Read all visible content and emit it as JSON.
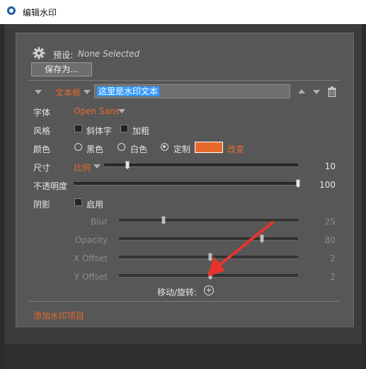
{
  "window": {
    "title": "编辑水印"
  },
  "preset": {
    "label": "预设:",
    "value": "None Selected",
    "save_as": "保存为..."
  },
  "item": {
    "type_label": "文本框",
    "text": "这里是水印文本"
  },
  "font": {
    "label": "字体",
    "value": "Open Sans"
  },
  "style": {
    "label": "风格",
    "italic": "斜体字",
    "bold": "加粗"
  },
  "color": {
    "label": "颜色",
    "black": "黑色",
    "white": "白色",
    "custom": "定制",
    "change": "改变",
    "swatch": "#e8692c",
    "selected": "custom"
  },
  "size": {
    "label": "尺寸",
    "mode": "比例",
    "value": "10",
    "level": 0.12
  },
  "opacity": {
    "label": "不透明度",
    "value": "100",
    "level": 1.0
  },
  "shadow": {
    "label": "阴影",
    "enable": "启用",
    "blur": {
      "label": "Blur",
      "value": "25",
      "level": 0.25
    },
    "opacity": {
      "label": "Opacity",
      "value": "80",
      "level": 0.8
    },
    "x_offset": {
      "label": "X Offset",
      "value": "2",
      "level": 0.51
    },
    "y_offset": {
      "label": "Y Offset",
      "value": "2",
      "level": 0.51
    }
  },
  "move": {
    "label": "移动/旋转:"
  },
  "add_item": "添加水印项目",
  "accent": "#e8692c",
  "annotation_arrow_color": "#e8342c"
}
